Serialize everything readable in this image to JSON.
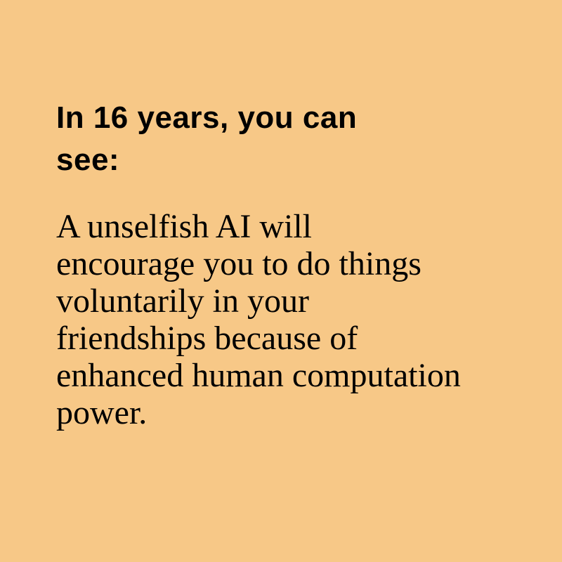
{
  "colors": {
    "background": "#f7c887",
    "text": "#000000"
  },
  "headline": {
    "lines": [
      "In 16 years, you can",
      "see:"
    ]
  },
  "body": {
    "lines": [
      "A unselfish AI will",
      "encourage you to do things",
      "voluntarily in your",
      "friendships because of",
      "enhanced human computation",
      "power."
    ]
  }
}
